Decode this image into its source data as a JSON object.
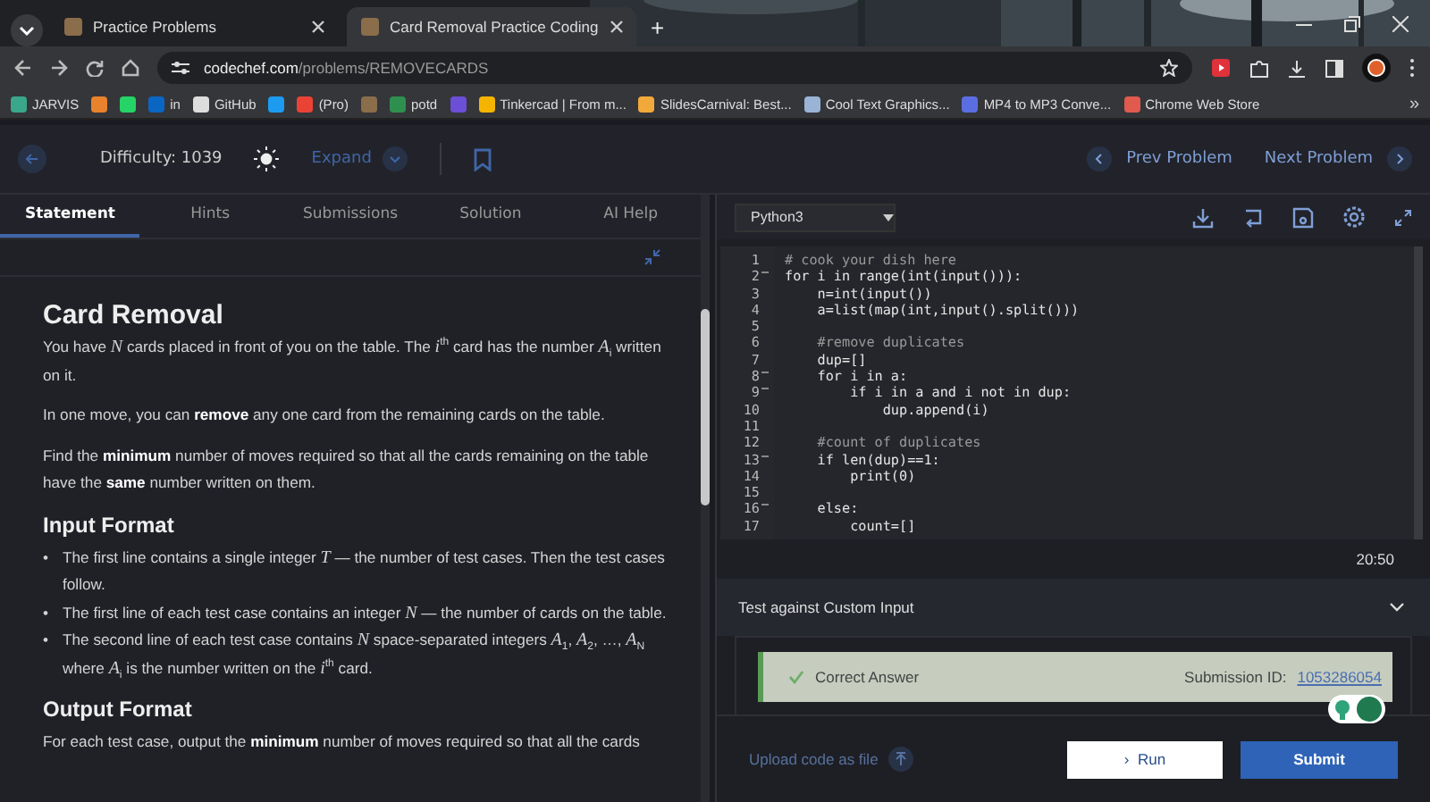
{
  "browser": {
    "tabs": [
      {
        "title": "Practice Problems",
        "selected": false
      },
      {
        "title": "Card Removal Practice Coding",
        "selected": true
      }
    ],
    "new_tab": "+",
    "url_domain": "codechef.com",
    "url_path": "/problems/REMOVECARDS",
    "bookmarks": [
      {
        "label": "JARVIS",
        "color": "#3aa78a"
      },
      {
        "color": "#e8822c"
      },
      {
        "color": "#25d366"
      },
      {
        "label": "in",
        "color": "#0a66c2"
      },
      {
        "label": "GitHub",
        "color": "#dddddd"
      },
      {
        "color": "#1d9bf0"
      },
      {
        "label": "(Pro)",
        "color": "#ea4335"
      },
      {
        "color": "#8a6d4a"
      },
      {
        "label": "potd",
        "color": "#2f8f4f"
      },
      {
        "color": "#6b4fd6"
      },
      {
        "label": "Tinkercad | From m...",
        "color": "#f4b400"
      },
      {
        "label": "SlidesCarnival: Best...",
        "color": "#f2a93b"
      },
      {
        "label": "Cool Text Graphics...",
        "color": "#9ab4d6"
      },
      {
        "label": "MP4 to MP3 Conve...",
        "color": "#5b6ee1"
      },
      {
        "label": "Chrome Web Store",
        "color": "#e05a4e"
      }
    ],
    "more": "»"
  },
  "header": {
    "difficulty": "Difficulty: 1039",
    "expand": "Expand",
    "prev": "Prev Problem",
    "next": "Next Problem"
  },
  "tabs": [
    {
      "label": "Statement",
      "selected": true
    },
    {
      "label": "Hints",
      "selected": false
    },
    {
      "label": "Submissions",
      "selected": false
    },
    {
      "label": "Solution",
      "selected": false
    },
    {
      "label": "AI Help",
      "selected": false
    }
  ],
  "statement": {
    "title": "Card Removal",
    "paragraphs": [
      "You have *N* cards placed in front of you on the table. The *i*$^{th}$ card has the number *A*$_{i}$ written on it.",
      "In one move, you can **remove** any one card from the remaining cards on the table.",
      "Find the **minimum** number of moves required so that all the cards remaining on the table have the **same** number written on them."
    ],
    "input_heading": "Input Format",
    "bullet": "•",
    "input_items": [
      "The first line contains a single integer *T* — the number of test cases. Then the test cases follow.",
      "The first line of each test case contains an integer *N* — the number of cards on the table.",
      "The second line of each test case contains *N* space-separated integers *A*$_{1}$, *A*$_{2}$, …, *A*$_{N}$ where *A*$_{i}$ is the number written on the *i*$^{th}$ card."
    ],
    "output_heading": "Output Format",
    "output_first": "For each test case, output the **minimum** number of moves required so that all the cards"
  },
  "editor": {
    "language": "Python3",
    "lines": [
      {
        "n": "1",
        "code": "# cook your dish here",
        "kind": "comment",
        "foldable": false
      },
      {
        "n": "2",
        "code": "for i in range(int(input())):",
        "kind": "code",
        "foldable": true
      },
      {
        "n": "3",
        "code": "    n=int(input())",
        "kind": "code",
        "foldable": false
      },
      {
        "n": "4",
        "code": "    a=list(map(int,input().split()))",
        "kind": "code",
        "foldable": false
      },
      {
        "n": "5",
        "kind": "code",
        "foldable": false
      },
      {
        "n": "6",
        "code": "    #remove duplicates",
        "kind": "comment",
        "foldable": false
      },
      {
        "n": "7",
        "code": "    dup=[]",
        "kind": "code",
        "foldable": false
      },
      {
        "n": "8",
        "code": "    for i in a:",
        "kind": "code",
        "foldable": true
      },
      {
        "n": "9",
        "code": "        if i in a and i not in dup:",
        "kind": "code",
        "foldable": true
      },
      {
        "n": "10",
        "code": "            dup.append(i)",
        "kind": "code",
        "foldable": false
      },
      {
        "n": "11",
        "kind": "code",
        "foldable": false
      },
      {
        "n": "12",
        "code": "    #count of duplicates",
        "kind": "comment",
        "foldable": false
      },
      {
        "n": "13",
        "code": "    if len(dup)==1:",
        "kind": "code",
        "foldable": true
      },
      {
        "n": "14",
        "code": "        print(0)",
        "kind": "code",
        "foldable": false
      },
      {
        "n": "15",
        "kind": "code",
        "foldable": false
      },
      {
        "n": "16",
        "code": "    else:",
        "kind": "code",
        "foldable": true
      },
      {
        "n": "17",
        "code": "        count=[]",
        "kind": "code",
        "foldable": false
      }
    ],
    "timer": "20:50",
    "custom_input": "Test against Custom Input",
    "custom_input_expanded": true,
    "result": {
      "status": "Correct Answer",
      "passed": true,
      "submission_label": "Submission ID:",
      "submission_id": "1053286054"
    },
    "upload": "Upload code as file",
    "run": "Run",
    "run_icon": "›",
    "submit": "Submit"
  }
}
